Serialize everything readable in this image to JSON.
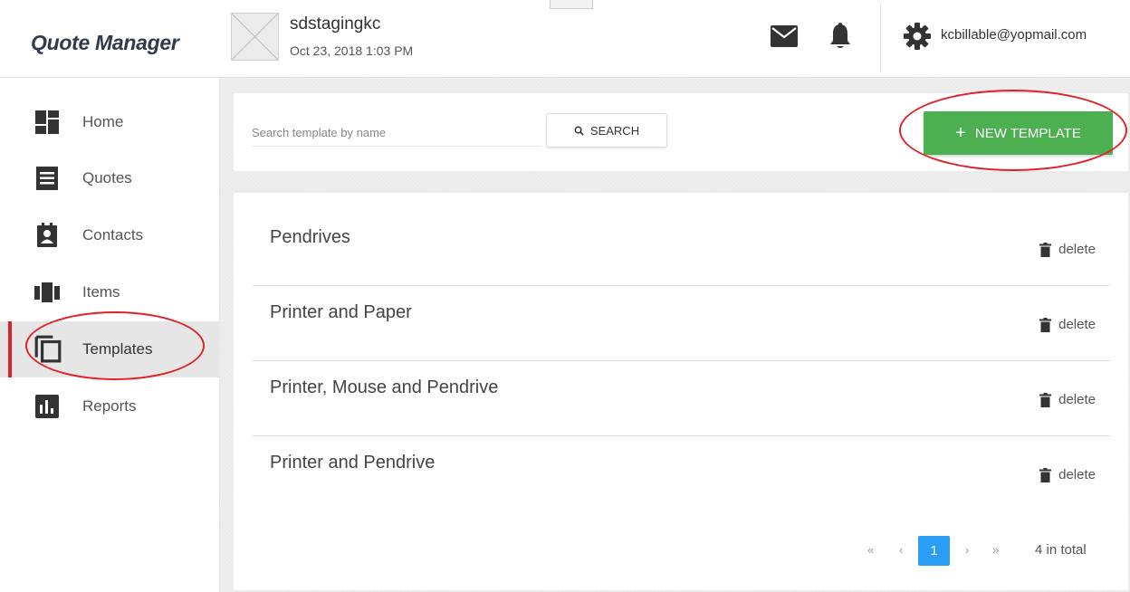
{
  "app": {
    "title": "Quote Manager"
  },
  "company": {
    "name": "sdstagingkc",
    "date": "Oct 23, 2018 1:03 PM"
  },
  "user": {
    "email": "kcbillable@yopmail.com"
  },
  "icons": {
    "mail": "mail-icon",
    "bell": "bell-icon",
    "gear": "gear-icon",
    "home": "dashboard-icon",
    "quotes": "document-icon",
    "contacts": "contact-book-icon",
    "items": "items-icon",
    "templates": "copy-icon",
    "reports": "bar-chart-icon",
    "search": "search-icon",
    "plus": "plus-icon",
    "trash": "trash-icon"
  },
  "sidebar": {
    "items": [
      {
        "label": "Home"
      },
      {
        "label": "Quotes"
      },
      {
        "label": "Contacts"
      },
      {
        "label": "Items"
      },
      {
        "label": "Templates",
        "active": true
      },
      {
        "label": "Reports"
      }
    ]
  },
  "toolbar": {
    "search_placeholder": "Search template by name",
    "search_label": "SEARCH",
    "new_template_plus": "+",
    "new_template_label": "NEW TEMPLATE"
  },
  "templates": [
    {
      "name": "Pendrives",
      "delete_label": "delete"
    },
    {
      "name": "Printer and Paper",
      "delete_label": "delete"
    },
    {
      "name": "Printer, Mouse and Pendrive",
      "delete_label": "delete"
    },
    {
      "name": "Printer and Pendrive",
      "delete_label": "delete"
    }
  ],
  "pagination": {
    "first": "«",
    "prev": "‹",
    "current": "1",
    "next": "›",
    "last": "»",
    "total": "4 in total"
  },
  "colors": {
    "accent_red": "#d9232d",
    "new_template_green": "#4caf50",
    "pager_blue": "#2a9df4",
    "annotation_red": "#e2212b"
  }
}
